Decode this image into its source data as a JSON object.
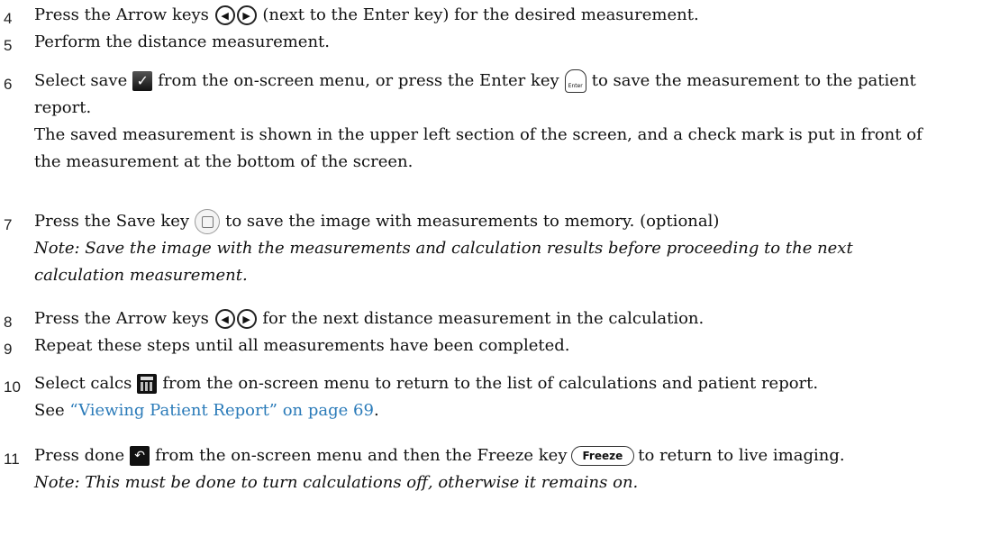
{
  "steps": [
    {
      "num": "4",
      "text_a": "Press the Arrow keys",
      "text_b": "(next to the Enter key) for the desired measurement.",
      "left_arrow_icon": "◀",
      "right_arrow_icon": "▶"
    },
    {
      "num": "5",
      "text": "Perform the distance measurement."
    },
    {
      "num": "6",
      "text_a": "Select save",
      "text_b": "from the on-screen menu, or press the Enter key",
      "text_c": "to save the measurement to the patient report.",
      "check_icon": "✓",
      "enter_key_label": "Enter",
      "subtext": "The saved measurement is shown in the upper left section of the screen, and a check mark is put in front of the measurement at the bottom of the screen."
    },
    {
      "num": "7",
      "text_a": "Press the Save key",
      "text_b": "to save the image with measurements to memory. (optional)",
      "note": "Note:  Save the image with the measurements and calculation results before proceeding to the next calculation measurement."
    },
    {
      "num": "8",
      "text_a": "Press the Arrow keys",
      "text_b": "for the next distance measurement in the calculation.",
      "left_arrow_icon": "◀",
      "right_arrow_icon": "▶"
    },
    {
      "num": "9",
      "text": "Repeat these steps until all measurements have been completed."
    },
    {
      "num": "10",
      "text_a": "Select calcs",
      "text_b": "from the on-screen menu to return to the list of calculations and patient report.",
      "text_c": "See",
      "link": "“Viewing Patient Report” on page 69",
      "text_d": "."
    },
    {
      "num": "11",
      "text_a": "Press done",
      "text_b": "from the on-screen menu and then the Freeze key",
      "freeze_label": "Freeze",
      "text_c": "to return to live imaging.",
      "done_icon": "↶",
      "note": "Note:  This must be done to turn calculations off, otherwise it remains on."
    }
  ],
  "colors": {
    "link": "#2b7bb9",
    "text": "#111111"
  }
}
